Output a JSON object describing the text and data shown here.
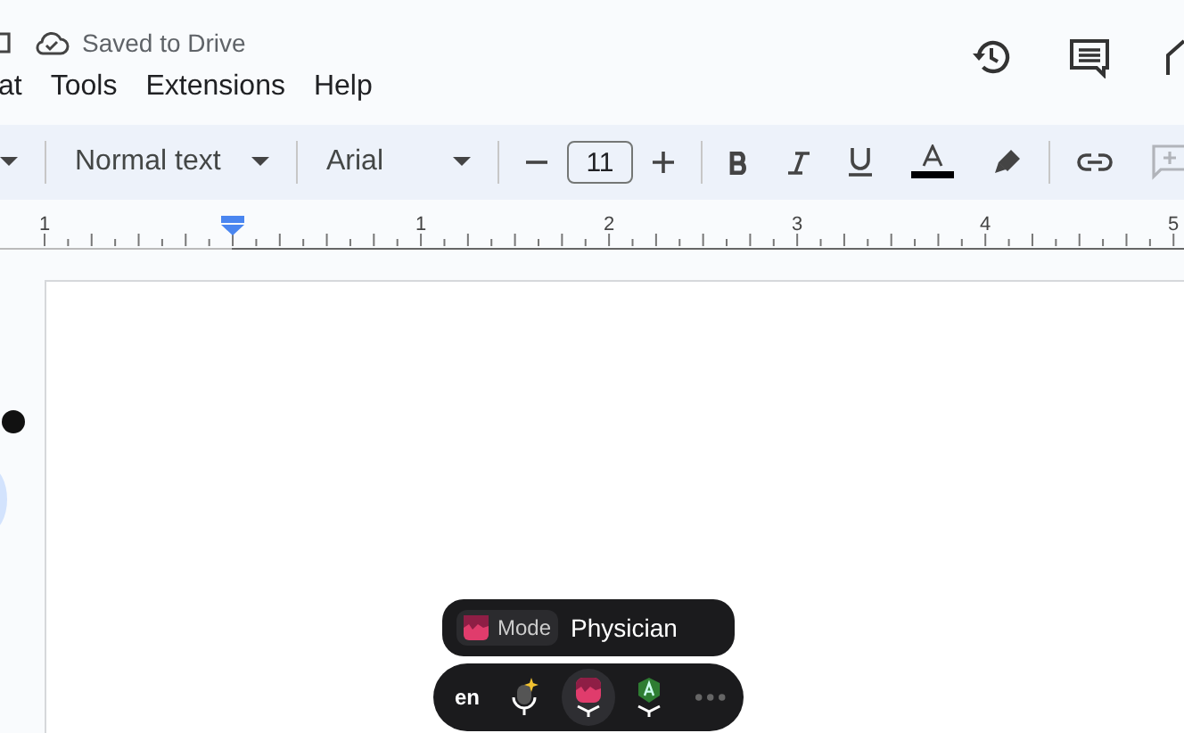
{
  "header": {
    "save_status": "Saved to Drive",
    "menu": [
      "at",
      "Tools",
      "Extensions",
      "Help"
    ]
  },
  "toolbar": {
    "style": "Normal text",
    "font": "Arial",
    "font_size": "11",
    "add_comment": {
      "disabled": true
    }
  },
  "ruler": {
    "numbers": [
      "1",
      "1",
      "2",
      "3",
      "4",
      "5"
    ]
  },
  "assistant": {
    "mode_label": "Mode",
    "mode_value": "Physician",
    "language": "en",
    "buttons": [
      {
        "kind": "sparkle-mic",
        "selected": false
      },
      {
        "kind": "mode-mic",
        "selected": true
      },
      {
        "kind": "badge-mic",
        "selected": false
      }
    ]
  }
}
